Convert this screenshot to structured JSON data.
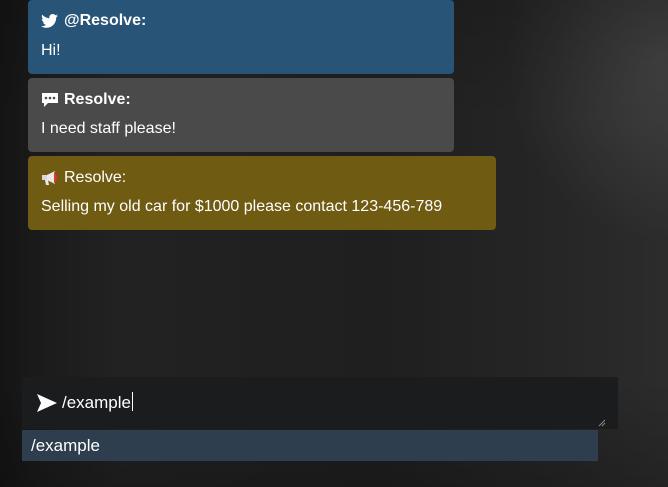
{
  "messages": [
    {
      "kind": "twitter",
      "icon": "twitter-bird-icon",
      "author": "@Resolve:",
      "text": "Hi!",
      "color": "#285478"
    },
    {
      "kind": "chat",
      "icon": "speech-bubble-icon",
      "author": "Resolve:",
      "text": "I need staff please!",
      "color": "#4a4a4a"
    },
    {
      "kind": "advertisement",
      "icon": "megaphone-icon",
      "author": "Resolve:",
      "text": "Selling my old car for $1000 please contact 123-456-789",
      "color": "#6f5b12"
    }
  ],
  "input": {
    "icon": "send-arrow-icon",
    "value": "/example"
  },
  "suggestions": [
    {
      "label": "/example"
    }
  ]
}
